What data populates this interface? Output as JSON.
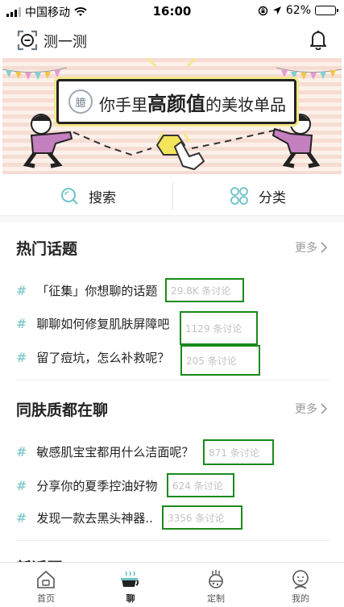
{
  "status_bar": {
    "carrier": "中国移动",
    "time": "16:00",
    "battery": "62%",
    "battery_level": 0.62
  },
  "header": {
    "title": "测一测"
  },
  "banner": {
    "badge": "臆",
    "text_before": "你手里",
    "text_highlight": "高颜值",
    "text_after": "的美妆单品"
  },
  "quick": {
    "search_label": "搜索",
    "category_label": "分类"
  },
  "hot": {
    "title": "热门话题",
    "more": "更多",
    "topics": [
      {
        "title": "「征集」你想聊的话题",
        "count": "29.8K 条讨论"
      },
      {
        "title": "聊聊如何修复肌肤屏障吧",
        "count": "1129 条讨论"
      },
      {
        "title": "留了痘坑，怎么补救呢？",
        "count": "205 条讨论"
      }
    ]
  },
  "same_skin": {
    "title": "同肤质都在聊",
    "more": "更多",
    "topics": [
      {
        "title": "敏感肌宝宝都用什么洁面呢？",
        "count": "871 条讨论"
      },
      {
        "title": "分享你的夏季控油好物",
        "count": "624 条讨论"
      },
      {
        "title": "发现一款去黑头神器..",
        "count": "3356 条讨论"
      }
    ]
  },
  "next_section": {
    "title": "新话题"
  },
  "tabs": [
    {
      "label": "首页",
      "icon": "house-icon"
    },
    {
      "label": "聊",
      "icon": "coffee-cup-icon"
    },
    {
      "label": "定制",
      "icon": "lab-flask-icon"
    },
    {
      "label": "我的",
      "icon": "person-icon"
    }
  ],
  "colors": {
    "accent": "#6fc2c7",
    "highlight_border": "#1b8a1b",
    "banner_stripe": "#f6dcd3",
    "banner_figure": "#c47fbf"
  }
}
